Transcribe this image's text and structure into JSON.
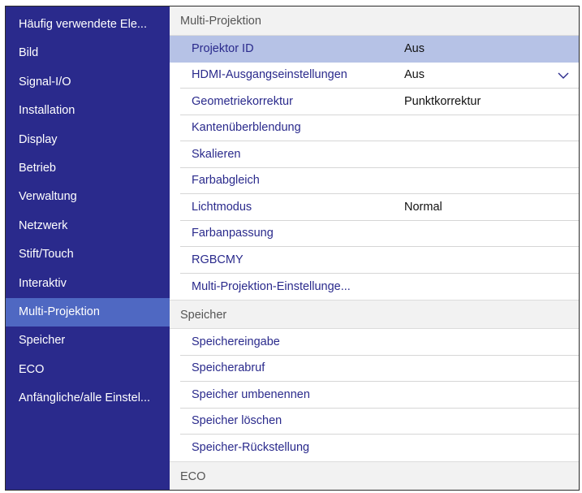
{
  "sidebar": {
    "items": [
      {
        "label": "Häufig verwendete Ele...",
        "active": false
      },
      {
        "label": "Bild",
        "active": false
      },
      {
        "label": "Signal-I/O",
        "active": false
      },
      {
        "label": "Installation",
        "active": false
      },
      {
        "label": "Display",
        "active": false
      },
      {
        "label": "Betrieb",
        "active": false
      },
      {
        "label": "Verwaltung",
        "active": false
      },
      {
        "label": "Netzwerk",
        "active": false
      },
      {
        "label": "Stift/Touch",
        "active": false
      },
      {
        "label": "Interaktiv",
        "active": false
      },
      {
        "label": "Multi-Projektion",
        "active": true
      },
      {
        "label": "Speicher",
        "active": false
      },
      {
        "label": "ECO",
        "active": false
      },
      {
        "label": "Anfängliche/alle Einstel...",
        "active": false
      }
    ]
  },
  "sections": {
    "multi": {
      "header": "Multi-Projektion",
      "rows": [
        {
          "label": "Projektor ID",
          "value": "Aus"
        },
        {
          "label": "HDMI-Ausgangseinstellungen",
          "value": "Aus"
        },
        {
          "label": "Geometriekorrektur",
          "value": "Punktkorrektur"
        },
        {
          "label": "Kantenüberblendung",
          "value": ""
        },
        {
          "label": "Skalieren",
          "value": ""
        },
        {
          "label": "Farbabgleich",
          "value": ""
        },
        {
          "label": "Lichtmodus",
          "value": "Normal"
        },
        {
          "label": "Farbanpassung",
          "value": ""
        },
        {
          "label": "RGBCMY",
          "value": ""
        },
        {
          "label": "Multi-Projektion-Einstellunge...",
          "value": ""
        }
      ]
    },
    "speicher": {
      "header": "Speicher",
      "rows": [
        {
          "label": "Speichereingabe"
        },
        {
          "label": "Speicherabruf"
        },
        {
          "label": "Speicher umbenennen"
        },
        {
          "label": "Speicher löschen"
        },
        {
          "label": "Speicher-Rückstellung"
        }
      ]
    },
    "eco": {
      "header": "ECO"
    }
  },
  "icons": {
    "dropdown": "chevron-down-icon"
  },
  "colors": {
    "sidebar_bg": "#2a2a8c",
    "sidebar_active": "#4f68c2",
    "row_selected": "#b6c2e6",
    "label_text": "#2a2a8c"
  }
}
